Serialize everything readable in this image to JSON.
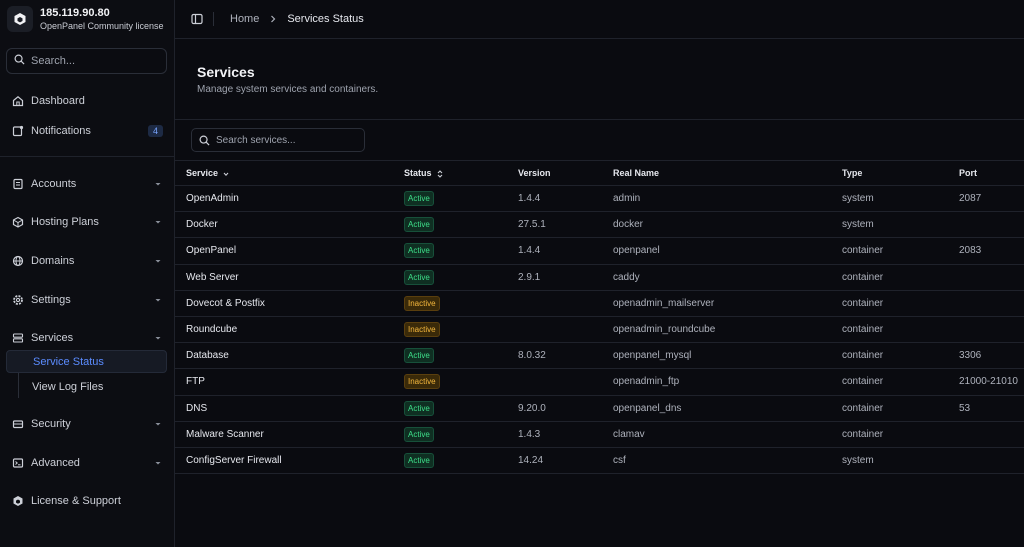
{
  "brand": {
    "ip": "185.119.90.80",
    "license": "OpenPanel Community license"
  },
  "sidebar": {
    "search_placeholder": "Search...",
    "dashboard": "Dashboard",
    "notifications": "Notifications",
    "notifications_count": "4",
    "accounts": "Accounts",
    "hosting_plans": "Hosting Plans",
    "domains": "Domains",
    "settings": "Settings",
    "services": "Services",
    "service_status": "Service Status",
    "view_log_files": "View Log Files",
    "security": "Security",
    "advanced": "Advanced",
    "license_support": "License & Support"
  },
  "breadcrumb": {
    "home": "Home",
    "current": "Services Status"
  },
  "page": {
    "title": "Services",
    "subtitle": "Manage system services and containers."
  },
  "table": {
    "search_placeholder": "Search services...",
    "headers": {
      "service": "Service",
      "status": "Status",
      "version": "Version",
      "real_name": "Real Name",
      "type": "Type",
      "port": "Port"
    },
    "rows": [
      {
        "service": "OpenAdmin",
        "status": "Active",
        "version": "1.4.4",
        "real_name": "admin",
        "type": "system",
        "port": "2087"
      },
      {
        "service": "Docker",
        "status": "Active",
        "version": "27.5.1",
        "real_name": "docker",
        "type": "system",
        "port": ""
      },
      {
        "service": "OpenPanel",
        "status": "Active",
        "version": "1.4.4",
        "real_name": "openpanel",
        "type": "container",
        "port": "2083"
      },
      {
        "service": "Web Server",
        "status": "Active",
        "version": "2.9.1",
        "real_name": "caddy",
        "type": "container",
        "port": ""
      },
      {
        "service": "Dovecot & Postfix",
        "status": "Inactive",
        "version": "",
        "real_name": "openadmin_mailserver",
        "type": "container",
        "port": ""
      },
      {
        "service": "Roundcube",
        "status": "Inactive",
        "version": "",
        "real_name": "openadmin_roundcube",
        "type": "container",
        "port": ""
      },
      {
        "service": "Database",
        "status": "Active",
        "version": "8.0.32",
        "real_name": "openpanel_mysql",
        "type": "container",
        "port": "3306"
      },
      {
        "service": "FTP",
        "status": "Inactive",
        "version": "",
        "real_name": "openadmin_ftp",
        "type": "container",
        "port": "21000-21010"
      },
      {
        "service": "DNS",
        "status": "Active",
        "version": "9.20.0",
        "real_name": "openpanel_dns",
        "type": "container",
        "port": "53"
      },
      {
        "service": "Malware Scanner",
        "status": "Active",
        "version": "1.4.3",
        "real_name": "clamav",
        "type": "container",
        "port": ""
      },
      {
        "service": "ConfigServer Firewall",
        "status": "Active",
        "version": "14.24",
        "real_name": "csf",
        "type": "system",
        "port": ""
      }
    ]
  }
}
